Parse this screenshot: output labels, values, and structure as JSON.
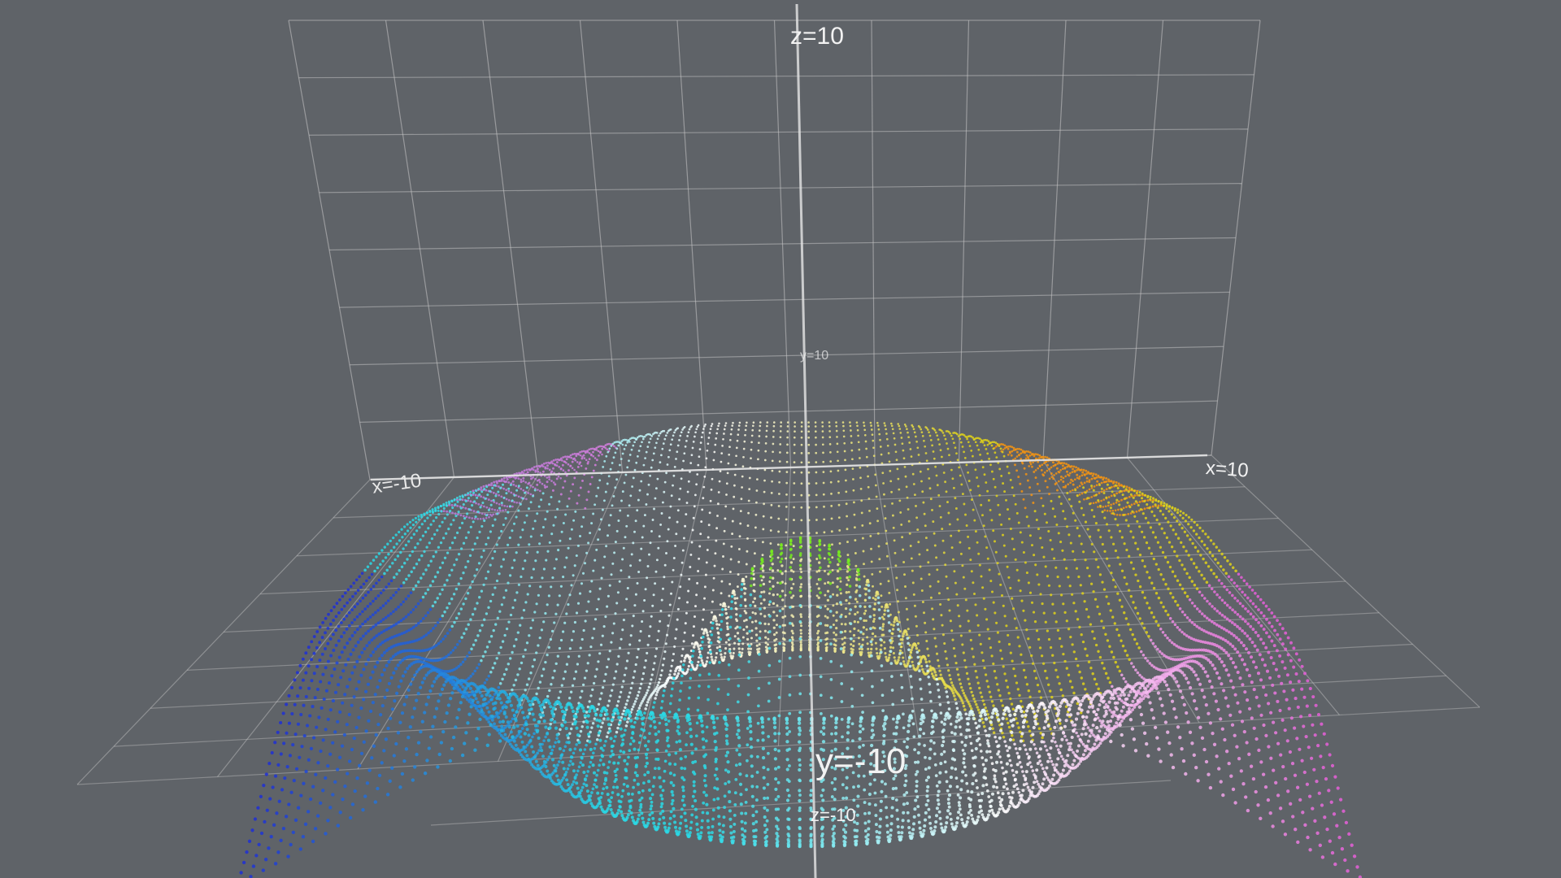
{
  "scene": {
    "background_color": "#5f6368",
    "grid_color": "#c8c8c8",
    "axis_color": "#e6e6e6",
    "surface_colormap": [
      "#1e2fd6",
      "#2ad9e6",
      "#ffffff",
      "#e65ad8",
      "#e0d21a",
      "#ff7a10",
      "#66ee22"
    ]
  },
  "labels": {
    "z_top": "z=10",
    "z_bottom": "z=-10",
    "x_negative": "x=-10",
    "x_positive": "x=10",
    "y_negative": "y=-10",
    "y_positive": "y=10"
  }
}
